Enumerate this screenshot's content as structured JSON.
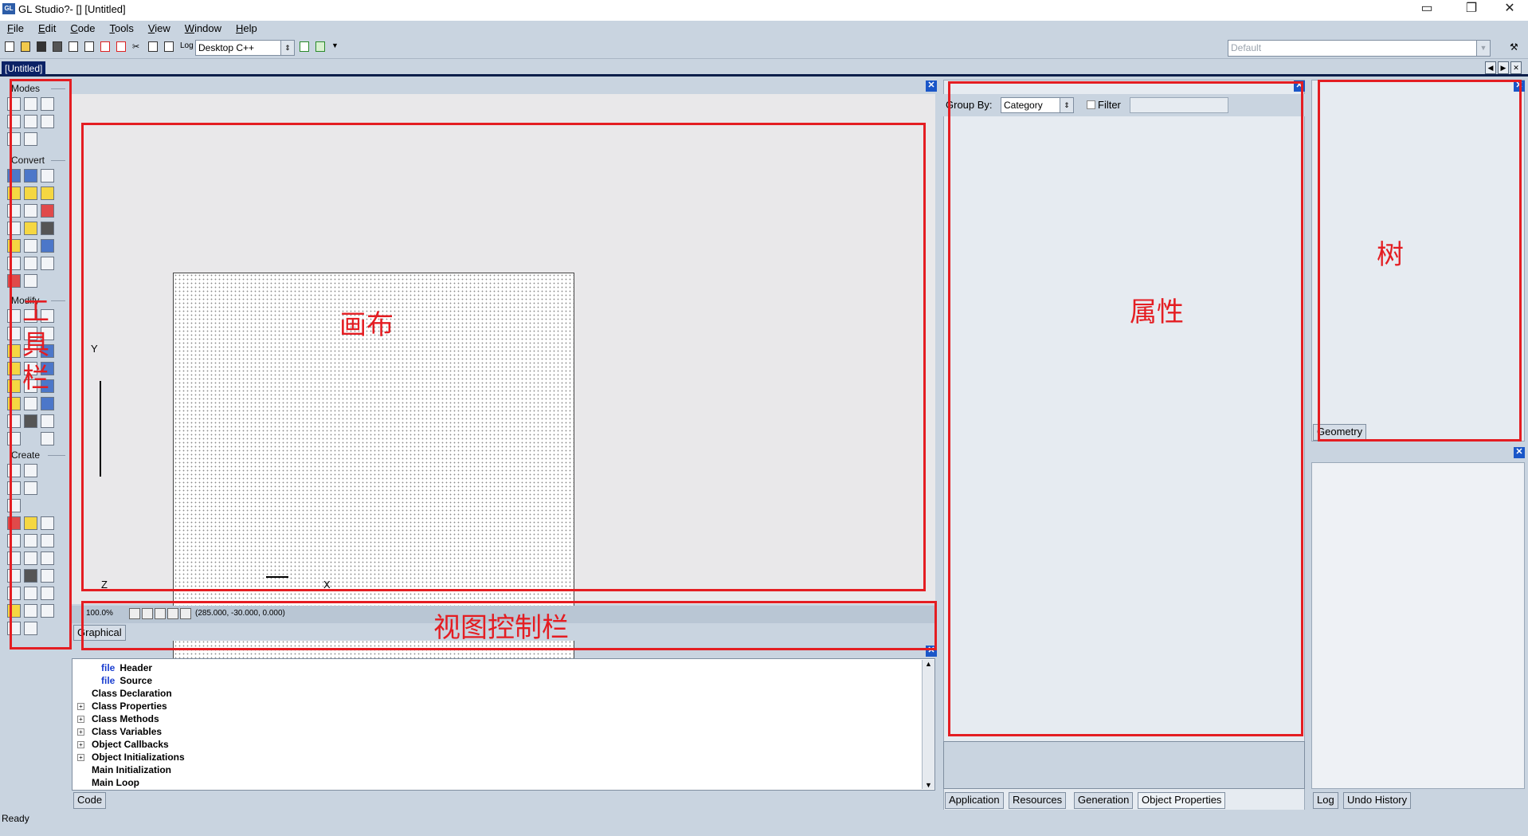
{
  "window": {
    "title": "GL Studio?-  [] [Untitled]",
    "controls": [
      "minimize",
      "restore",
      "close"
    ]
  },
  "menu": [
    "File",
    "Edit",
    "Code",
    "Tools",
    "View",
    "Window",
    "Help"
  ],
  "toolbar": {
    "log_label": "Log",
    "platform_value": "Desktop C++",
    "profile_placeholder": "Default"
  },
  "doc_tab": "[Untitled]",
  "sidebar": {
    "groups": [
      "Modes",
      "Convert",
      "Modify",
      "Create"
    ]
  },
  "canvas": {
    "axis_y": "Y",
    "axis_x": "X",
    "axis_z": "Z"
  },
  "view_control": {
    "zoom": "100.0%",
    "coords": "(285.000, -30.000, 0.000)",
    "tab": "Graphical"
  },
  "code_tree": {
    "items": [
      {
        "kw": "file",
        "label": "Header",
        "expandable": false
      },
      {
        "kw": "file",
        "label": "Source",
        "expandable": false
      },
      {
        "kw": "",
        "label": "Class Declaration",
        "expandable": false
      },
      {
        "kw": "",
        "label": "Class Properties",
        "expandable": true
      },
      {
        "kw": "",
        "label": "Class Methods",
        "expandable": true
      },
      {
        "kw": "",
        "label": "Class Variables",
        "expandable": true
      },
      {
        "kw": "",
        "label": "Object Callbacks",
        "expandable": true
      },
      {
        "kw": "",
        "label": "Object Initializations",
        "expandable": true
      },
      {
        "kw": "",
        "label": "Main Initialization",
        "expandable": false
      },
      {
        "kw": "",
        "label": "Main Loop",
        "expandable": false
      }
    ],
    "tab": "Code"
  },
  "properties": {
    "group_by_label": "Group By:",
    "group_by_value": "Category",
    "filter_label": "Filter",
    "tabs": [
      "Application",
      "Resources",
      "Generation",
      "Object Properties"
    ]
  },
  "tree_panel": {
    "tab": "Geometry"
  },
  "log_panel": {
    "tabs": [
      "Log",
      "Undo History"
    ]
  },
  "annotations": {
    "toolbar": "工具栏",
    "canvas": "画布",
    "view_control": "视图控制栏",
    "properties": "属性",
    "tree": "树"
  },
  "status": "Ready"
}
